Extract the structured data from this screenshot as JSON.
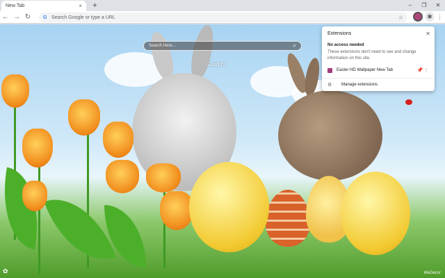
{
  "tab": {
    "title": "New Tab",
    "close": "×",
    "new": "+"
  },
  "window": {
    "minimize": "–",
    "restore": "❐",
    "close": "✕"
  },
  "toolbar": {
    "back": "←",
    "forward": "→",
    "reload": "↻",
    "omnibox_placeholder": "Search Google or type a URL",
    "g_icon": "G",
    "star": "☆",
    "puzzle": "✱",
    "menu": "⋮"
  },
  "page": {
    "search_placeholder": "Search Here...",
    "search_icon": "⌕",
    "greeting": "Good m",
    "signature": "MeDecor",
    "gear": "✿"
  },
  "extensions": {
    "title": "Extensions",
    "close": "✕",
    "subhead": "No access needed",
    "desc": "These extensions don't need to see and change information on this site.",
    "items": [
      {
        "name": "Easter HD Wallpaper New Tab",
        "pin": "📌",
        "menu": "⋮"
      }
    ],
    "manage_icon": "⚙",
    "manage_label": "Manage extensions"
  },
  "colors": {
    "accent": "#1a73e8",
    "ext_icon": "#a43d7c"
  }
}
